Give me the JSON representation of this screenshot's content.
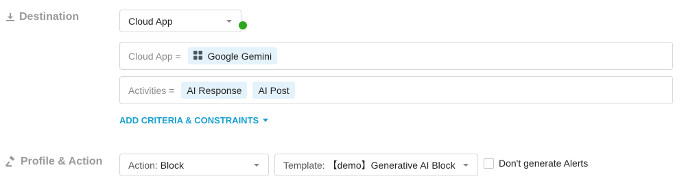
{
  "destination": {
    "label": "Destination",
    "select_value": "Cloud App",
    "status_color": "#2ea51e",
    "icon": "download-icon"
  },
  "criteria": [
    {
      "label": "Cloud App =",
      "chips": [
        {
          "text": "Google Gemini",
          "icon": "app-grid-icon"
        }
      ]
    },
    {
      "label": "Activities =",
      "chips": [
        {
          "text": "AI Response"
        },
        {
          "text": "AI Post"
        }
      ]
    }
  ],
  "add_criteria_label": "ADD CRITERIA & CONSTRAINTS",
  "profile_action": {
    "label": "Profile & Action",
    "icon": "gavel-icon",
    "action": {
      "prefix": "Action:",
      "value": "Block"
    },
    "template": {
      "prefix": "Template:",
      "value": "【demo】Generative AI Block"
    },
    "alerts_checkbox": {
      "label": "Don't generate Alerts",
      "checked": false
    }
  },
  "colors": {
    "accent": "#1aa0cf",
    "chip_bg": "#e4f2fb",
    "label_gray": "#9a9a9a"
  }
}
